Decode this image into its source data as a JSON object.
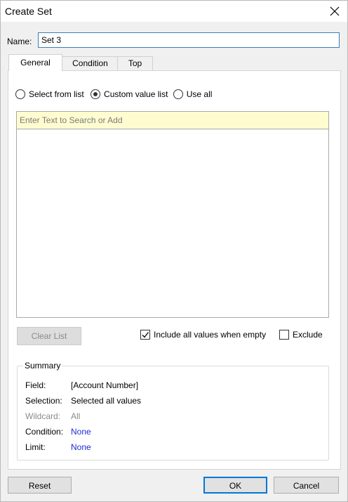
{
  "window": {
    "title": "Create Set"
  },
  "name_field": {
    "label": "Name:",
    "value": "Set 3"
  },
  "tabs": [
    {
      "label": "General",
      "active": true
    },
    {
      "label": "Condition",
      "active": false
    },
    {
      "label": "Top",
      "active": false
    }
  ],
  "mode_options": [
    {
      "label": "Select from list",
      "selected": false
    },
    {
      "label": "Custom value list",
      "selected": true
    },
    {
      "label": "Use all",
      "selected": false
    }
  ],
  "search": {
    "placeholder": "Enter Text to Search or Add"
  },
  "clear_list_label": "Clear List",
  "include_all_when_empty": {
    "label": "Include all values when empty",
    "checked": true
  },
  "exclude": {
    "label": "Exclude",
    "checked": false
  },
  "summary": {
    "title": "Summary",
    "rows": [
      {
        "key": "Field:",
        "value": "[Account Number]"
      },
      {
        "key": "Selection:",
        "value": "Selected all values"
      },
      {
        "key": "Wildcard:",
        "value": "All"
      },
      {
        "key": "Condition:",
        "value": "None"
      },
      {
        "key": "Limit:",
        "value": "None"
      }
    ]
  },
  "buttons": {
    "reset": "Reset",
    "ok": "OK",
    "cancel": "Cancel"
  },
  "colors": {
    "link": "#1f2ad8",
    "focus_border": "#0078d7",
    "search_bg": "#fffdd0"
  }
}
